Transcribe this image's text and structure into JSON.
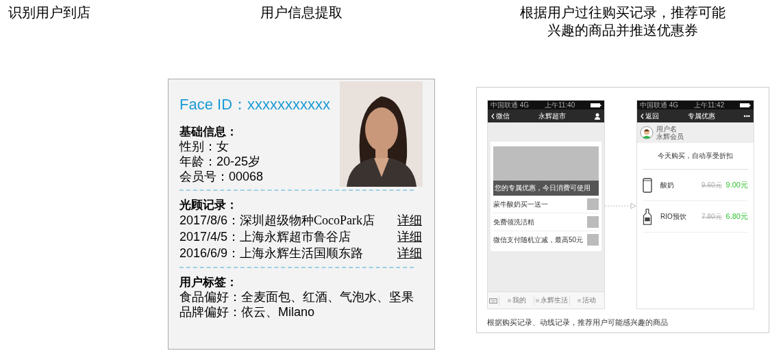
{
  "headings": [
    "识别用户到店",
    "用户信息提取",
    "根据用户过往购买记录，推荐可能兴趣的商品并推送优惠券"
  ],
  "card": {
    "face_id_label": "Face ID：",
    "face_id_value": "xxxxxxxxxxx",
    "sections": [
      {
        "heading": "基础信息：",
        "lines": [
          {
            "label": "性别：",
            "value": "女"
          },
          {
            "label": "年龄：",
            "value": "20-25岁"
          },
          {
            "label": "会员号：",
            "value": "00068"
          }
        ]
      },
      {
        "heading": "光顾记录：",
        "visits": [
          {
            "date": "2017/8/6：",
            "store": "深圳超级物种CocoPark店",
            "link": "详细"
          },
          {
            "date": "2017/4/5：",
            "store": "上海永辉超市鲁谷店",
            "link": "详细"
          },
          {
            "date": "2016/6/9：",
            "store": "上海永辉生活国顺东路",
            "link": "详细"
          }
        ]
      },
      {
        "heading": "用户标签：",
        "lines": [
          {
            "label": "食品偏好：",
            "value": "全麦面包、红酒、气泡水、坚果"
          },
          {
            "label": "品牌偏好：",
            "value": "依云、Milano"
          }
        ]
      }
    ]
  },
  "phone_a": {
    "carrier": "中国联通 4G",
    "time": "上午11:40",
    "back": "微信",
    "title": "永辉超市",
    "banner": "您的专属优惠，今日消费可使用",
    "items": [
      "蒙牛酸奶买一送一",
      "免费领洗洁精",
      "微信支付随机立减，最高50元"
    ],
    "tabs": [
      "我的",
      "永辉生活",
      "活动"
    ]
  },
  "phone_b": {
    "carrier": "中国联通 4G",
    "time": "上午11:42",
    "back": "返回",
    "title": "专属优惠",
    "more": "•••",
    "user_name": "用户名",
    "member": "永辉会员",
    "notice": "今天购买，自动享受折扣",
    "products": [
      {
        "kind": "cup",
        "name": "酸奶",
        "old_price": "9.60元",
        "price": "9.00元"
      },
      {
        "kind": "bottle",
        "name": "RIO预饮",
        "old_price": "7.80元",
        "price": "6.80元"
      }
    ]
  },
  "caption": "根据购买记录、动线记录，推荐用户可能感兴趣的商品"
}
